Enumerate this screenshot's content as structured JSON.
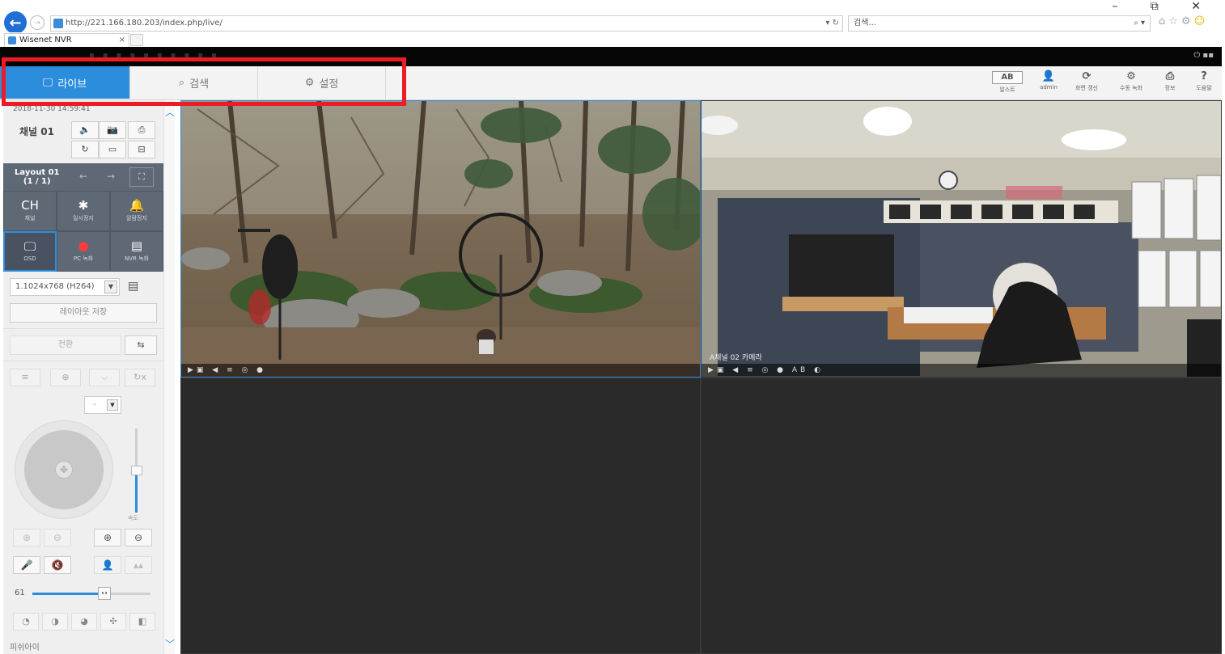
{
  "browser": {
    "url": "http://221.166.180.203/index.php/live/",
    "search_placeholder": "검색...",
    "tab_title": "Wisenet NVR",
    "window_controls": "–  ⧉  ✕"
  },
  "nav": {
    "live": "라이브",
    "search": "검색",
    "setup": "설정"
  },
  "top_tools": [
    {
      "glyph": "AB",
      "label": "알스트"
    },
    {
      "glyph": "👤",
      "label": "admin"
    },
    {
      "glyph": "⟳",
      "label": "화면 갱신"
    },
    {
      "glyph": "⚙",
      "label": "수동 녹화"
    },
    {
      "glyph": "⎙",
      "label": "정보"
    },
    {
      "glyph": "?",
      "label": "도움말"
    }
  ],
  "left": {
    "datetime": "2018-11-30  14:59:41",
    "channel": "채널 01",
    "layout_name": "Layout 01",
    "layout_page": "(1 / 1)",
    "grid_buttons": [
      {
        "glyph": "CH",
        "label": "채널"
      },
      {
        "glyph": "✱",
        "label": "일시정지"
      },
      {
        "glyph": "🔔",
        "label": "알람정지"
      },
      {
        "glyph": "🖵",
        "label": "OSD"
      },
      {
        "glyph": "●",
        "label": "PC 녹화"
      },
      {
        "glyph": "▤",
        "label": "NVR 녹화"
      }
    ],
    "resolution": "1.1024x768 (H264)",
    "save_layout": "레이아웃 저장",
    "switch": "전환",
    "preset_value": "-",
    "speed_label": "속도",
    "volume": "61",
    "fisheye": "피쉬아이"
  },
  "cameras": [
    {
      "title": "",
      "bar": "▶▣ ◀ ≡ ◎ ●"
    },
    {
      "title": "A채널 02 카메라",
      "bar": "▶▣ ◀ ≡ ◎ ● AB ◐"
    }
  ],
  "colors": {
    "accent": "#2d8ddd",
    "highlight": "#ec1c24",
    "panel_dark": "#5f6875"
  },
  "volume_fraction": 0.61
}
